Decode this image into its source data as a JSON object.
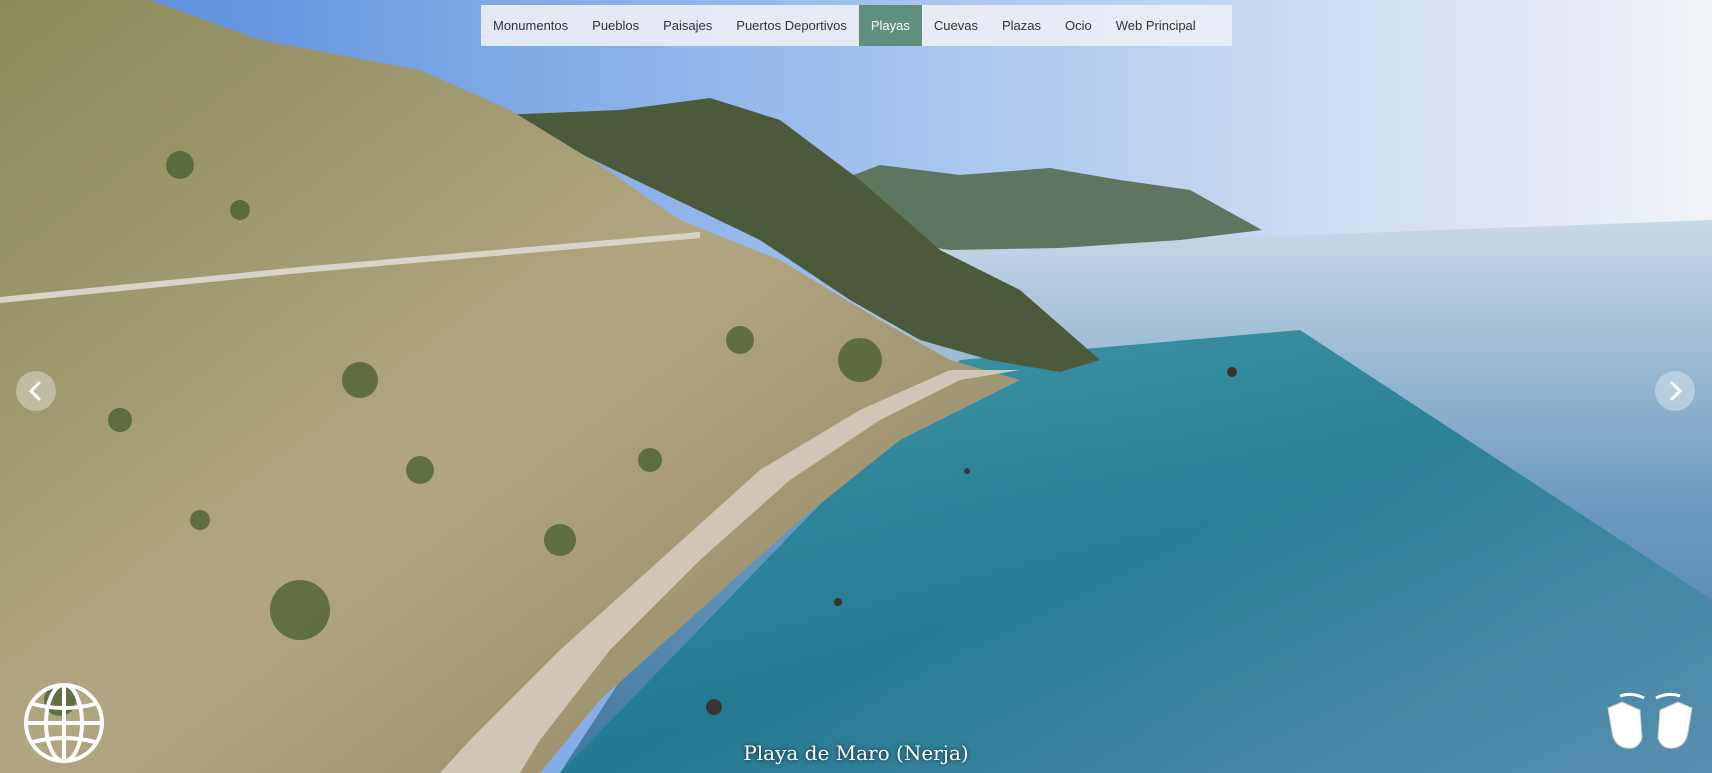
{
  "nav": {
    "items": [
      "Monumentos",
      "Pueblos",
      "Paisajes",
      "Puertos Deportivos",
      "Playas",
      "Cuevas",
      "Plazas",
      "Ocio",
      "Web Principal"
    ],
    "active": "Playas",
    "active_color": "#5f8f7f"
  },
  "viewer": {
    "caption": "Playa de Maro (Nerja)",
    "prev_icon": "chevron-left-icon",
    "next_icon": "chevron-right-icon",
    "globe_icon": "globe-icon",
    "gesture_icon": "swipe-hands-icon"
  },
  "colors": {
    "sky": "#4f86dc",
    "sea": "#1f7f8c",
    "sand": "#cfc6b5",
    "hills": "#a89c72"
  }
}
